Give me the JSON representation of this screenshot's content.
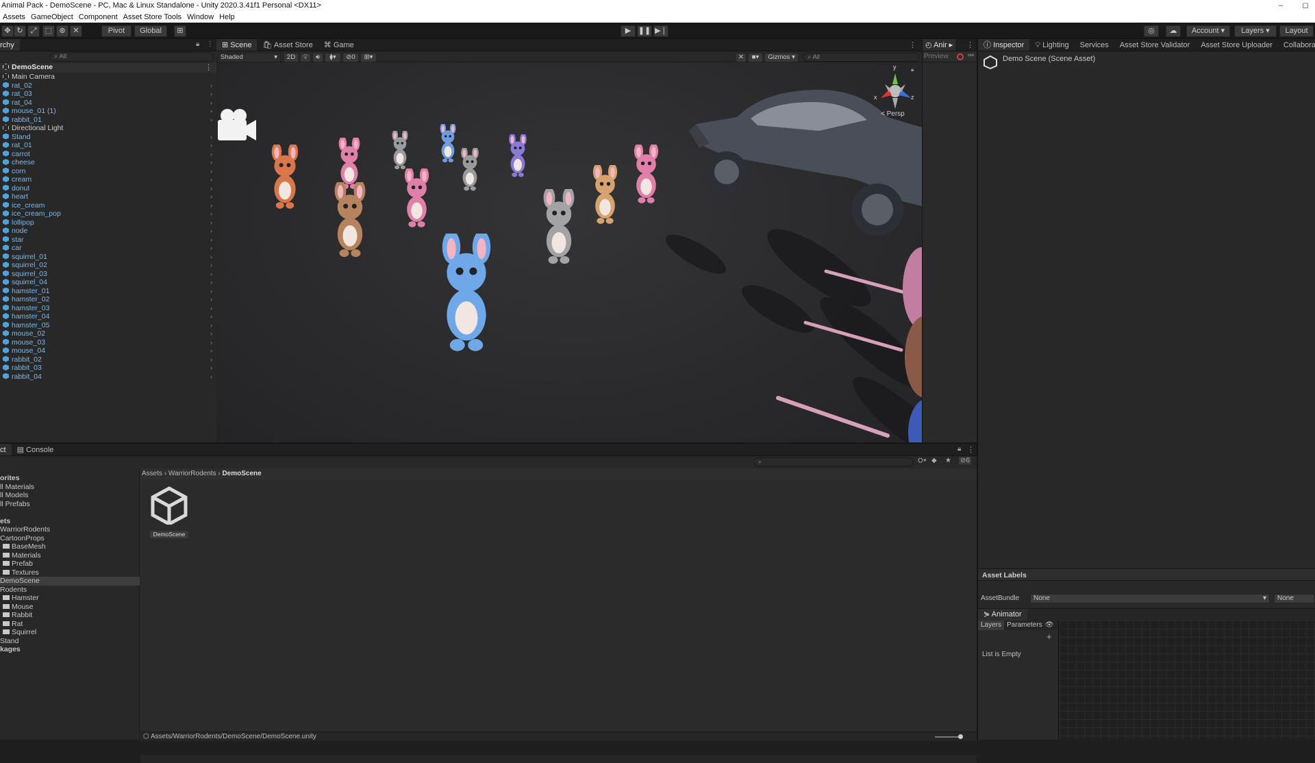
{
  "window": {
    "title": "Animal Pack - DemoScene - PC, Mac & Linux Standalone - Unity 2020.3.41f1 Personal <DX11>",
    "minimize": "–",
    "maximize": "◻"
  },
  "menu": [
    "Assets",
    "GameObject",
    "Component",
    "Asset Store Tools",
    "Window",
    "Help"
  ],
  "toolbar": {
    "pivot": "Pivot",
    "global": "Global",
    "account": "Account",
    "layers": "Layers",
    "layout": "Layout"
  },
  "hierarchy": {
    "tab": "rchy",
    "search_placeholder": "All",
    "scene": "DemoScene",
    "items": [
      {
        "label": "Main Camera",
        "type": "gameobject"
      },
      {
        "label": "rat_02",
        "type": "prefab"
      },
      {
        "label": "rat_03",
        "type": "prefab"
      },
      {
        "label": "rat_04",
        "type": "prefab"
      },
      {
        "label": "mouse_01 (1)",
        "type": "prefab"
      },
      {
        "label": "rabbit_01",
        "type": "prefab"
      },
      {
        "label": "Directional Light",
        "type": "gameobject"
      },
      {
        "label": "Stand",
        "type": "prefab"
      },
      {
        "label": "rat_01",
        "type": "prefab"
      },
      {
        "label": "carrot",
        "type": "prefab"
      },
      {
        "label": "cheese",
        "type": "prefab"
      },
      {
        "label": "corn",
        "type": "prefab"
      },
      {
        "label": "cream",
        "type": "prefab"
      },
      {
        "label": "donut",
        "type": "prefab"
      },
      {
        "label": "heart",
        "type": "prefab"
      },
      {
        "label": "ice_cream",
        "type": "prefab"
      },
      {
        "label": "ice_cream_pop",
        "type": "prefab"
      },
      {
        "label": "lollipop",
        "type": "prefab"
      },
      {
        "label": "node",
        "type": "prefab"
      },
      {
        "label": "star",
        "type": "prefab"
      },
      {
        "label": "car",
        "type": "prefab"
      },
      {
        "label": "squirrel_01",
        "type": "prefab"
      },
      {
        "label": "squirrel_02",
        "type": "prefab"
      },
      {
        "label": "squirrel_03",
        "type": "prefab"
      },
      {
        "label": "squirrel_04",
        "type": "prefab"
      },
      {
        "label": "hamster_01",
        "type": "prefab"
      },
      {
        "label": "hamster_02",
        "type": "prefab"
      },
      {
        "label": "hamster_03",
        "type": "prefab"
      },
      {
        "label": "hamster_04",
        "type": "prefab"
      },
      {
        "label": "hamster_05",
        "type": "prefab"
      },
      {
        "label": "mouse_02",
        "type": "prefab"
      },
      {
        "label": "mouse_03",
        "type": "prefab"
      },
      {
        "label": "mouse_04",
        "type": "prefab"
      },
      {
        "label": "rabbit_02",
        "type": "prefab"
      },
      {
        "label": "rabbit_03",
        "type": "prefab"
      },
      {
        "label": "rabbit_04",
        "type": "prefab"
      }
    ]
  },
  "scene_view": {
    "tabs": [
      "Scene",
      "Asset Store",
      "Game"
    ],
    "shading": "Shaded",
    "mode_2d": "2D",
    "fx_count": "0",
    "gizmos": "Gizmos",
    "search_placeholder": "All",
    "persp": "< Persp",
    "axis": {
      "x": "x",
      "y": "y",
      "z": "z"
    }
  },
  "animation_panel": {
    "tab": "Anir",
    "preview": "Preview"
  },
  "inspector": {
    "tabs": [
      "Inspector",
      "Lighting",
      "Services",
      "Asset Store Validator",
      "Asset Store Uploader",
      "Collaborate"
    ],
    "asset_name": "Demo Scene (Scene Asset)",
    "asset_labels": "Asset Labels",
    "assetbundle_label": "AssetBundle",
    "assetbundle_value": "None",
    "assetbundle_variant": "None"
  },
  "animator": {
    "tab": "Animator",
    "layers_tab": "Layers",
    "parameters_tab": "Parameters",
    "add": "+",
    "empty": "List is Empty"
  },
  "project": {
    "tabs": [
      "ct",
      "Console"
    ],
    "search_placeholder": "",
    "tree": [
      {
        "label": "orites",
        "folder": false,
        "bold": true
      },
      {
        "label": "ll Materials",
        "folder": false
      },
      {
        "label": "ll Models",
        "folder": false
      },
      {
        "label": "ll Prefabs",
        "folder": false
      },
      {
        "label": "",
        "folder": false
      },
      {
        "label": "ets",
        "folder": false,
        "bold": true
      },
      {
        "label": "WarriorRodents",
        "folder": false
      },
      {
        "label": "CartoonProps",
        "folder": false
      },
      {
        "label": "BaseMesh",
        "folder": true
      },
      {
        "label": "Materials",
        "folder": true
      },
      {
        "label": "Prefab",
        "folder": true
      },
      {
        "label": "Textures",
        "folder": true
      },
      {
        "label": "DemoScene",
        "folder": false,
        "selected": true
      },
      {
        "label": "Rodents",
        "folder": false
      },
      {
        "label": "Hamster",
        "folder": true
      },
      {
        "label": "Mouse",
        "folder": true
      },
      {
        "label": "Rabbit",
        "folder": true
      },
      {
        "label": "Rat",
        "folder": true
      },
      {
        "label": "Squirrel",
        "folder": true
      },
      {
        "label": "Stand",
        "folder": false
      },
      {
        "label": "kages",
        "folder": false,
        "bold": true
      }
    ],
    "breadcrumb": [
      "Assets",
      "WarriorRodents",
      "DemoScene"
    ],
    "asset_item": "DemoScene",
    "status_path": "Assets/WarriorRodents/DemoScene/DemoScene.unity"
  },
  "colors": {
    "accent": "#4fa3d9",
    "panel": "#282828",
    "scene_bg": "#2b2b2d"
  }
}
